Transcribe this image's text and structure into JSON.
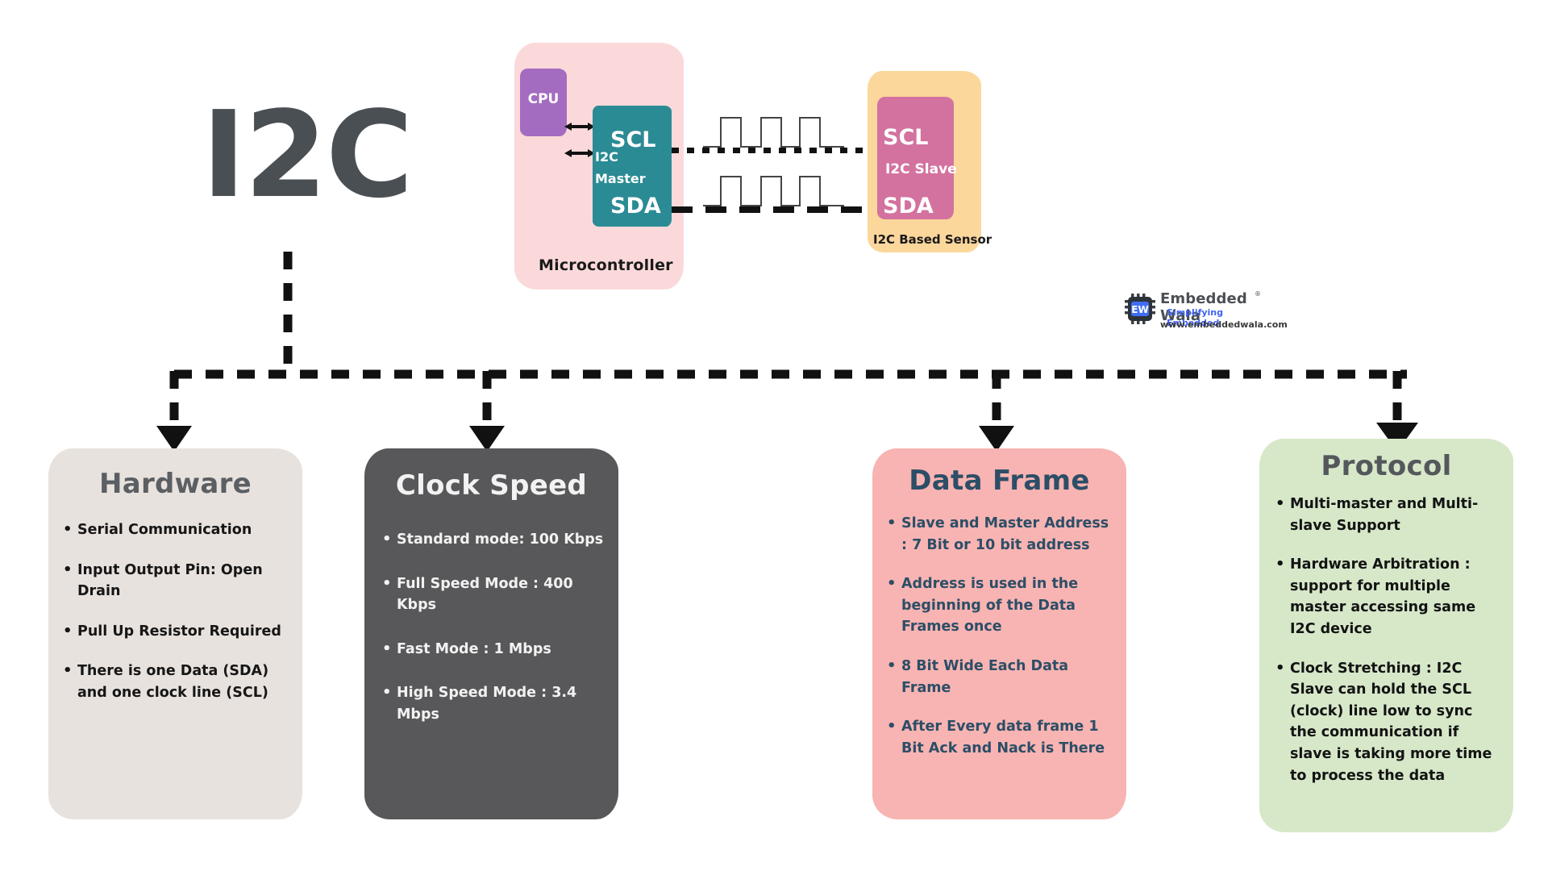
{
  "title": "I2C",
  "schematic": {
    "microcontroller_label": "Microcontroller",
    "cpu_label": "CPU",
    "master_name_line1": "I2C",
    "master_name_line2": "Master",
    "master_scl": "SCL",
    "master_sda": "SDA",
    "slave_scl": "SCL",
    "slave_name": "I2C Slave",
    "slave_sda": "SDA",
    "sensor_label": "I2C Based Sensor",
    "colors": {
      "microcontroller": "#fbd9da",
      "cpu": "#a46cc0",
      "master": "#2b8b95",
      "sensor": "#fbd79c",
      "slave": "#d3729f"
    }
  },
  "logo": {
    "mark": "EW",
    "name": "Embedded Wala",
    "registered": "®",
    "tagline": "Simplifying Embedded",
    "url": "www.embeddedwala.com",
    "accent": "#4062f0"
  },
  "cards": [
    {
      "id": "hardware",
      "title": "Hardware",
      "background": "#e8e2de",
      "title_color": "#5b5f63",
      "text_color": "#161616",
      "items": [
        "Serial Communication",
        "Input Output Pin: Open Drain",
        "Pull Up Resistor Required",
        "There is one Data (SDA) and one clock line (SCL)"
      ]
    },
    {
      "id": "clock",
      "title": "Clock Speed",
      "background": "#58585a",
      "title_color": "#f2f2f2",
      "text_color": "#f2f2f2",
      "items": [
        "Standard mode: 100 Kbps",
        "Full Speed Mode : 400 Kbps",
        "Fast Mode : 1 Mbps",
        "High Speed Mode : 3.4 Mbps"
      ]
    },
    {
      "id": "dataframe",
      "title": "Data Frame",
      "background": "#f8b4b2",
      "title_color": "#2c4e67",
      "text_color": "#2c4e67",
      "items": [
        "Slave and Master Address : 7 Bit or 10 bit address",
        "Address is used in the beginning of the Data Frames once",
        "8 Bit Wide Each Data Frame",
        "After Every data frame 1 Bit Ack and Nack is There"
      ]
    },
    {
      "id": "protocol",
      "title": "Protocol",
      "background": "#d7e8c9",
      "title_color": "#54585c",
      "text_color": "#131313",
      "items": [
        "Multi-master and Multi-slave Support",
        "Hardware Arbitration : support for multiple master accessing same I2C device",
        "Clock Stretching : I2C Slave can hold the SCL (clock) line low to sync the communication if slave is taking more time to process the data"
      ]
    }
  ]
}
